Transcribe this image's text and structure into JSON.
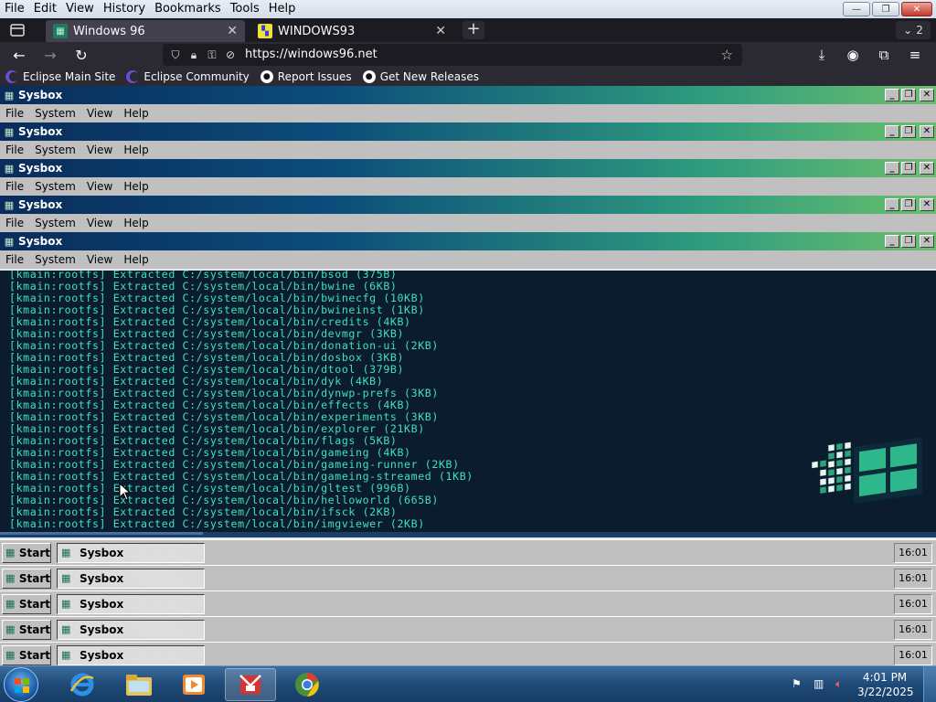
{
  "browser": {
    "menus": [
      "File",
      "Edit",
      "View",
      "History",
      "Bookmarks",
      "Tools",
      "Help"
    ],
    "window_controls": {
      "minimize": "—",
      "restore": "❐",
      "close": "✕"
    },
    "tabs": [
      {
        "title": "Windows 96",
        "active": true
      },
      {
        "title": "WINDOWS93",
        "active": false
      }
    ],
    "new_tab": "+",
    "tab_overflow_count": "2",
    "url": "https://windows96.net",
    "bookmarks": [
      {
        "label": "Eclipse Main Site",
        "icon": "eclipse-icon"
      },
      {
        "label": "Eclipse Community",
        "icon": "eclipse-icon"
      },
      {
        "label": "Report Issues",
        "icon": "github-icon"
      },
      {
        "label": "Get New Releases",
        "icon": "github-icon"
      }
    ]
  },
  "sysbox": {
    "title": "Sysbox",
    "menus": [
      "File",
      "System",
      "View",
      "Help"
    ],
    "window_count": 5
  },
  "terminal": {
    "lines": [
      "[kmain:rootfs] Extracted C:/system/local/bin/bsod (375B)",
      "[kmain:rootfs] Extracted C:/system/local/bin/bwine (6KB)",
      "[kmain:rootfs] Extracted C:/system/local/bin/bwinecfg (10KB)",
      "[kmain:rootfs] Extracted C:/system/local/bin/bwineinst (1KB)",
      "[kmain:rootfs] Extracted C:/system/local/bin/credits (4KB)",
      "[kmain:rootfs] Extracted C:/system/local/bin/devmgr (3KB)",
      "[kmain:rootfs] Extracted C:/system/local/bin/donation-ui (2KB)",
      "[kmain:rootfs] Extracted C:/system/local/bin/dosbox (3KB)",
      "[kmain:rootfs] Extracted C:/system/local/bin/dtool (379B)",
      "[kmain:rootfs] Extracted C:/system/local/bin/dyk (4KB)",
      "[kmain:rootfs] Extracted C:/system/local/bin/dynwp-prefs (3KB)",
      "[kmain:rootfs] Extracted C:/system/local/bin/effects (4KB)",
      "[kmain:rootfs] Extracted C:/system/local/bin/experiments (3KB)",
      "[kmain:rootfs] Extracted C:/system/local/bin/explorer (21KB)",
      "[kmain:rootfs] Extracted C:/system/local/bin/flags (5KB)",
      "[kmain:rootfs] Extracted C:/system/local/bin/gameing (4KB)",
      "[kmain:rootfs] Extracted C:/system/local/bin/gameing-runner (2KB)",
      "[kmain:rootfs] Extracted C:/system/local/bin/gameing-streamed (1KB)",
      "[kmain:rootfs] Extracted C:/system/local/bin/gltest (996B)",
      "[kmain:rootfs] Extracted C:/system/local/bin/helloworld (665B)",
      "[kmain:rootfs] Extracted C:/system/local/bin/ifsck (2KB)",
      "[kmain:rootfs] Extracted C:/system/local/bin/imgviewer (2KB)"
    ]
  },
  "w96_taskbar": {
    "start_label": "Start",
    "task_label": "Sysbox",
    "clock": "16:01",
    "count": 5
  },
  "win7_taskbar": {
    "apps": [
      "internet-explorer-icon",
      "file-explorer-icon",
      "media-player-icon",
      "gitkraken-icon",
      "chrome-icon"
    ],
    "time": "4:01 PM",
    "date": "3/22/2025"
  },
  "colors": {
    "terminal_bg": "#0b1d2d",
    "terminal_text": "#3fe0c0",
    "title_gradient_start": "#0a2c5a",
    "title_gradient_end": "#6abf6e"
  }
}
